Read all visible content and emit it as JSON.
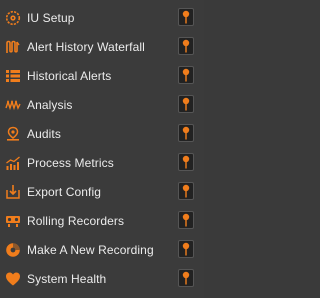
{
  "colors": {
    "background": "#3b3b3b",
    "text": "#ececec",
    "accent": "#f07d1c",
    "pin_button_bg": "#222222"
  },
  "menu": {
    "items": [
      {
        "label": "IU Setup",
        "icon": "gear-biohazard-icon"
      },
      {
        "label": "Alert History Waterfall",
        "icon": "waterfall-icon"
      },
      {
        "label": "Historical Alerts",
        "icon": "list-icon"
      },
      {
        "label": "Analysis",
        "icon": "waveform-icon"
      },
      {
        "label": "Audits",
        "icon": "location-pin-icon"
      },
      {
        "label": "Process Metrics",
        "icon": "trend-chart-icon"
      },
      {
        "label": "Export Config",
        "icon": "export-icon"
      },
      {
        "label": "Rolling Recorders",
        "icon": "recorder-icon"
      },
      {
        "label": "Make A New Recording",
        "icon": "record-disc-icon"
      },
      {
        "label": "System Health",
        "icon": "heart-icon"
      }
    ],
    "pin_icon": "pushpin-icon"
  }
}
